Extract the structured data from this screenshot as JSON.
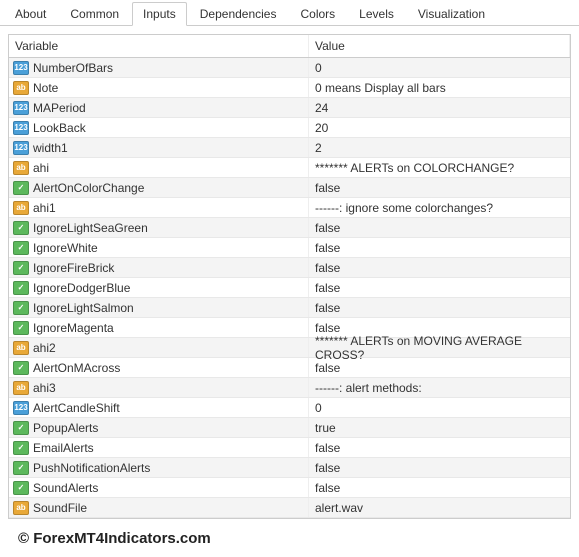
{
  "tabs": [
    {
      "label": "About"
    },
    {
      "label": "Common"
    },
    {
      "label": "Inputs"
    },
    {
      "label": "Dependencies"
    },
    {
      "label": "Colors"
    },
    {
      "label": "Levels"
    },
    {
      "label": "Visualization"
    }
  ],
  "headers": {
    "variable": "Variable",
    "value": "Value"
  },
  "rows": [
    {
      "type": "int",
      "name": "NumberOfBars",
      "value": "0"
    },
    {
      "type": "str",
      "name": "Note",
      "value": "0 means Display all bars"
    },
    {
      "type": "int",
      "name": "MAPeriod",
      "value": "24"
    },
    {
      "type": "int",
      "name": "LookBack",
      "value": "20"
    },
    {
      "type": "int",
      "name": "width1",
      "value": "2"
    },
    {
      "type": "str",
      "name": "ahi",
      "value": "******* ALERTs on COLORCHANGE?"
    },
    {
      "type": "bool",
      "name": "AlertOnColorChange",
      "value": "false"
    },
    {
      "type": "str",
      "name": "ahi1",
      "value": "------: ignore some colorchanges?"
    },
    {
      "type": "bool",
      "name": "IgnoreLightSeaGreen",
      "value": "false"
    },
    {
      "type": "bool",
      "name": "IgnoreWhite",
      "value": "false"
    },
    {
      "type": "bool",
      "name": "IgnoreFireBrick",
      "value": "false"
    },
    {
      "type": "bool",
      "name": "IgnoreDodgerBlue",
      "value": "false"
    },
    {
      "type": "bool",
      "name": "IgnoreLightSalmon",
      "value": "false"
    },
    {
      "type": "bool",
      "name": "IgnoreMagenta",
      "value": "false"
    },
    {
      "type": "str",
      "name": "ahi2",
      "value": "******* ALERTs on MOVING AVERAGE CROSS?"
    },
    {
      "type": "bool",
      "name": "AlertOnMAcross",
      "value": "false"
    },
    {
      "type": "str",
      "name": "ahi3",
      "value": "------: alert methods:"
    },
    {
      "type": "int",
      "name": "AlertCandleShift",
      "value": "0"
    },
    {
      "type": "bool",
      "name": "PopupAlerts",
      "value": "true"
    },
    {
      "type": "bool",
      "name": "EmailAlerts",
      "value": "false"
    },
    {
      "type": "bool",
      "name": "PushNotificationAlerts",
      "value": "false"
    },
    {
      "type": "bool",
      "name": "SoundAlerts",
      "value": "false"
    },
    {
      "type": "str",
      "name": "SoundFile",
      "value": "alert.wav"
    }
  ],
  "icon_text": {
    "int": "123",
    "str": "ab",
    "bool": "✓"
  },
  "watermark": "© ForexMT4Indicators.com"
}
